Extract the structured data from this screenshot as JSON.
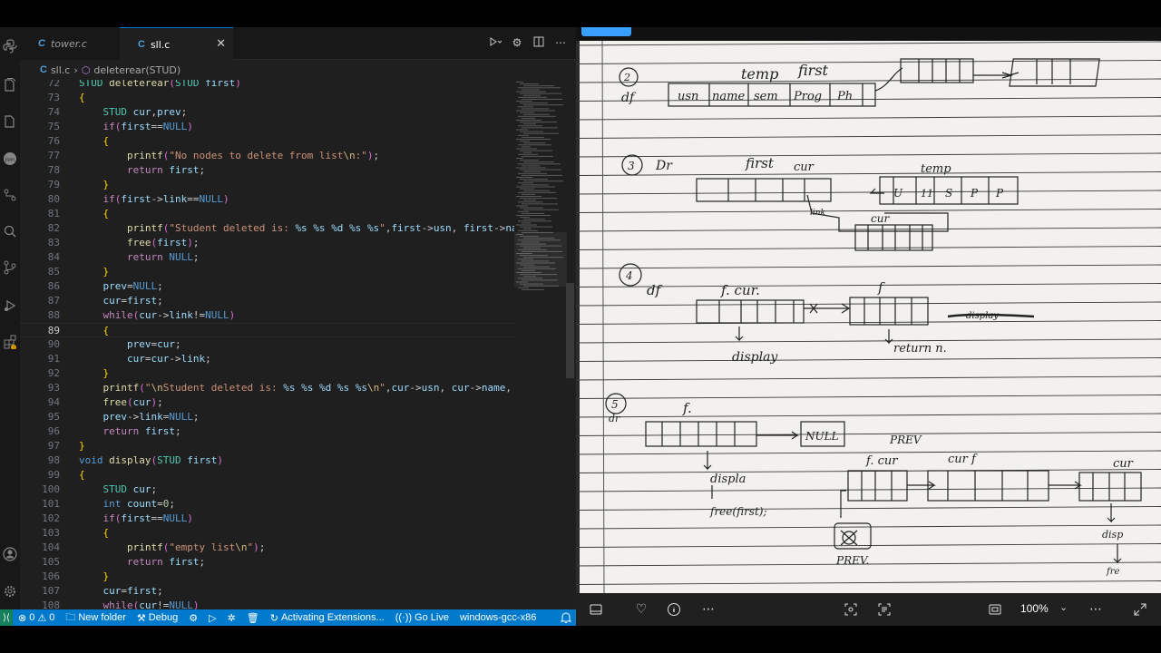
{
  "editor": {
    "tabs": [
      {
        "lang": "C",
        "label": "tower.c",
        "active": false
      },
      {
        "lang": "C",
        "label": "sll.c",
        "active": true
      }
    ],
    "breadcrumb": {
      "lang": "C",
      "file": "sll.c",
      "separator": "›",
      "symbol": "deleterear(STUD)"
    },
    "lines": [
      {
        "num": "72",
        "text": "STUD deleterear(STUD first)"
      },
      {
        "num": "73",
        "text": "{"
      },
      {
        "num": "74",
        "text": "    STUD cur,prev;"
      },
      {
        "num": "75",
        "text": "    if(first==NULL)"
      },
      {
        "num": "76",
        "text": "    {"
      },
      {
        "num": "77",
        "text": "        printf(\"No nodes to delete from list\\n:\");"
      },
      {
        "num": "78",
        "text": "        return first;"
      },
      {
        "num": "79",
        "text": "    }"
      },
      {
        "num": "80",
        "text": "    if(first->link==NULL)"
      },
      {
        "num": "81",
        "text": "    {"
      },
      {
        "num": "82",
        "text": "        printf(\"Student deleted is: %s %s %d %s %s\",first->usn, first->nam"
      },
      {
        "num": "83",
        "text": "        free(first);"
      },
      {
        "num": "84",
        "text": "        return NULL;"
      },
      {
        "num": "85",
        "text": "    }"
      },
      {
        "num": "86",
        "text": "    prev=NULL;"
      },
      {
        "num": "87",
        "text": "    cur=first;"
      },
      {
        "num": "88",
        "text": "    while(cur->link!=NULL)"
      },
      {
        "num": "89",
        "text": "    {"
      },
      {
        "num": "90",
        "text": "        prev=cur;"
      },
      {
        "num": "91",
        "text": "        cur=cur->link;"
      },
      {
        "num": "92",
        "text": "    }"
      },
      {
        "num": "93",
        "text": "    printf(\"\\nStudent deleted is: %s %s %d %s %s\\n\",cur->usn, cur->name, c"
      },
      {
        "num": "94",
        "text": "    free(cur);"
      },
      {
        "num": "95",
        "text": "    prev->link=NULL;"
      },
      {
        "num": "96",
        "text": "    return first;"
      },
      {
        "num": "97",
        "text": "}"
      },
      {
        "num": "98",
        "text": "void display(STUD first)"
      },
      {
        "num": "99",
        "text": "{"
      },
      {
        "num": "100",
        "text": "    STUD cur;"
      },
      {
        "num": "101",
        "text": "    int count=0;"
      },
      {
        "num": "102",
        "text": "    if(first==NULL)"
      },
      {
        "num": "103",
        "text": "    {"
      },
      {
        "num": "104",
        "text": "        printf(\"empty list\\n\");"
      },
      {
        "num": "105",
        "text": "        return first;"
      },
      {
        "num": "106",
        "text": "    }"
      },
      {
        "num": "107",
        "text": "    cur=first;"
      },
      {
        "num": "108",
        "text": "    while(cur!=NULL)"
      }
    ],
    "current_line": "89"
  },
  "statusbar": {
    "remote_icon": "remote-icon",
    "errors": "0",
    "warnings": "0",
    "new_folder": "New folder",
    "debug": "Debug",
    "activating": "Activating Extensions...",
    "go_live": "Go Live",
    "compiler": "windows-gcc-x86",
    "colors": {
      "bar": "#007acc",
      "remote": "#16825d"
    }
  },
  "viewer": {
    "zoom": "100%",
    "notes": {
      "section2": {
        "num": "2",
        "label": "df",
        "caption_temp": "temp",
        "caption_first": "first",
        "fields": [
          "usn",
          "name",
          "sem",
          "Prog",
          "Ph"
        ]
      },
      "section3": {
        "num": "3",
        "label": "Dr",
        "first": "first",
        "cur_top": "cur",
        "temp": "temp",
        "temp_fields": [
          "U",
          "11",
          "S",
          "P",
          "P"
        ],
        "link": "link",
        "cur_bottom": "cur"
      },
      "section4": {
        "num": "4",
        "label": "df",
        "f_cur": "f. cur.",
        "f_right": "f",
        "display": "display",
        "return_n": "return n.",
        "scratch": "display"
      },
      "section5": {
        "num": "5",
        "label": "dr",
        "f": "f.",
        "null": "NULL",
        "display": "displa",
        "free": "free(first);",
        "prev_top": "PREV",
        "f_cur": "f. cur",
        "cur_f": "cur f",
        "cur_right": "cur",
        "prev_bottom": "PREV.",
        "disp_right": "disp",
        "free_right": "fre"
      }
    }
  }
}
